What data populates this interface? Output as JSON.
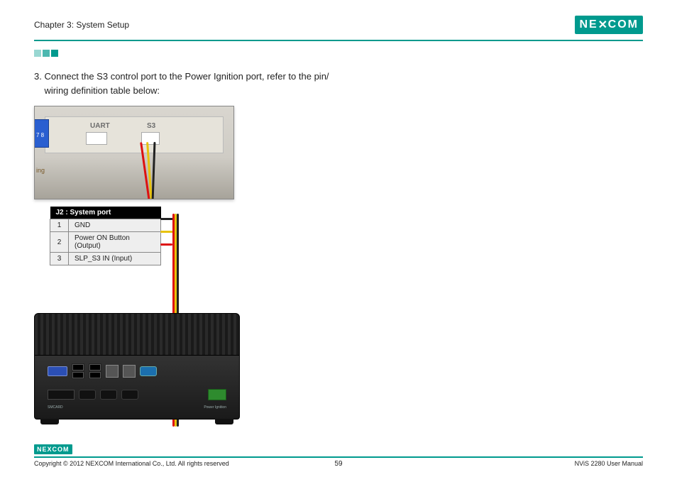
{
  "header": {
    "chapter": "Chapter 3: System Setup",
    "logo_text": "NE",
    "logo_text2": "COM"
  },
  "step": {
    "number": "3.",
    "text_line1": "Connect the S3 control port to the Power Ignition port, refer to the pin/",
    "text_line2": "wiring definition table below:"
  },
  "photo": {
    "blue_numbers": "7 8",
    "uart_label": "UART",
    "s3_label": "S3",
    "edge_text": "ing"
  },
  "pin_table": {
    "title": "J2 : System port",
    "rows": [
      {
        "pin": "1",
        "desc": "GND"
      },
      {
        "pin": "2",
        "desc": "Power ON Button (Output)"
      },
      {
        "pin": "3",
        "desc": "SLP_S3 IN (Input)"
      }
    ]
  },
  "device": {
    "port_label": "Power Ignition",
    "smcard": "SMCARD"
  },
  "footer": {
    "logo": "NEXCOM",
    "copyright": "Copyright © 2012 NEXCOM International Co., Ltd. All rights reserved",
    "page": "59",
    "doc": "NViS 2280 User Manual"
  }
}
